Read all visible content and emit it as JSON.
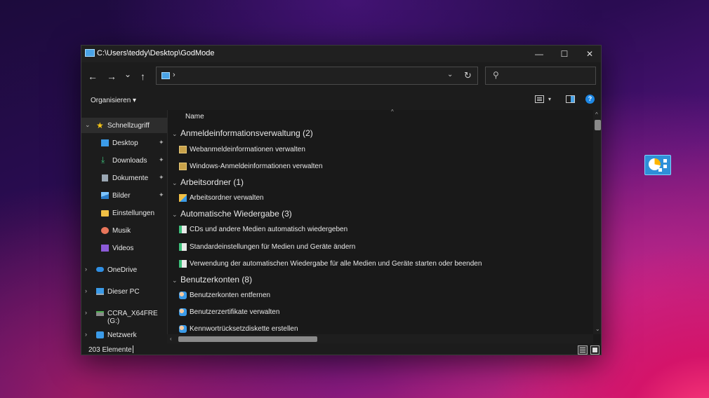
{
  "window": {
    "title": "C:\\Users\\teddy\\Desktop\\GodMode",
    "minimize_glyph": "—",
    "maximize_glyph": "☐",
    "close_glyph": "✕"
  },
  "nav": {
    "back_glyph": "←",
    "forward_glyph": "→",
    "recent_glyph": "⌄",
    "up_glyph": "↑",
    "address_separator": "›",
    "address_dropdown_glyph": "⌄",
    "refresh_glyph": "↻",
    "search_placeholder": "",
    "search_icon_glyph": "⚲"
  },
  "toolbar": {
    "organize_label": "Organisieren ▾",
    "view_caret": "▾",
    "help_glyph": "?"
  },
  "sidebar": {
    "items": [
      {
        "label": "Schnellzugriff",
        "icon": "star-icon",
        "icon_color": "#f5c518",
        "expanded": true,
        "selected": true
      },
      {
        "label": "Desktop",
        "icon": "desktop-icon",
        "icon_color": "#3b9be8",
        "pinned": true
      },
      {
        "label": "Downloads",
        "icon": "download-icon",
        "icon_color": "#3dbf7a",
        "pinned": true
      },
      {
        "label": "Dokumente",
        "icon": "document-icon",
        "icon_color": "#9aa7b3",
        "pinned": true
      },
      {
        "label": "Bilder",
        "icon": "pictures-icon",
        "icon_color": "#3b9be8",
        "pinned": true
      },
      {
        "label": "Einstellungen",
        "icon": "folder-icon",
        "icon_color": "#f1c045"
      },
      {
        "label": "Musik",
        "icon": "music-icon",
        "icon_color": "#e9765b"
      },
      {
        "label": "Videos",
        "icon": "video-icon",
        "icon_color": "#8c5bd8"
      },
      {
        "label": "OneDrive",
        "icon": "cloud-icon",
        "icon_color": "#2f8fe3"
      },
      {
        "label": "Dieser PC",
        "icon": "computer-icon",
        "icon_color": "#3b9be8"
      },
      {
        "label": "CCRA_X64FRE (G:)",
        "icon": "drive-icon",
        "icon_color": "#4caf50"
      },
      {
        "label": "Netzwerk",
        "icon": "network-icon",
        "icon_color": "#3b9be8"
      }
    ],
    "expand_glyph": "›",
    "collapse_glyph": "⌄",
    "pin_glyph": "📌"
  },
  "content": {
    "column_name": "Name",
    "sort_indicator": "^",
    "group_chevron": "⌄",
    "groups": [
      {
        "title": "Anmeldeinformationsverwaltung (2)",
        "items": [
          {
            "label": "Webanmeldeinformationen verwalten",
            "icon": "credential-vault-icon"
          },
          {
            "label": "Windows-Anmeldeinformationen verwalten",
            "icon": "credential-vault-icon"
          }
        ]
      },
      {
        "title": "Arbeitsordner (1)",
        "items": [
          {
            "label": "Arbeitsordner verwalten",
            "icon": "work-folders-icon"
          }
        ]
      },
      {
        "title": "Automatische Wiedergabe (3)",
        "items": [
          {
            "label": "CDs und andere Medien automatisch wiedergeben",
            "icon": "autoplay-icon"
          },
          {
            "label": "Standardeinstellungen für Medien und Geräte ändern",
            "icon": "autoplay-icon"
          },
          {
            "label": "Verwendung der automatischen Wiedergabe für alle Medien und Geräte starten oder beenden",
            "icon": "autoplay-icon"
          }
        ]
      },
      {
        "title": "Benutzerkonten (8)",
        "items": [
          {
            "label": "Benutzerkonten entfernen",
            "icon": "user-accounts-icon"
          },
          {
            "label": "Benutzerzertifikate verwalten",
            "icon": "user-accounts-icon"
          },
          {
            "label": "Kennwortrücksetzdiskette erstellen",
            "icon": "user-accounts-icon"
          }
        ]
      }
    ]
  },
  "status": {
    "item_count": "203 Elemente"
  },
  "scroll": {
    "up_glyph": "^",
    "down_glyph": "⌄",
    "left_glyph": "‹"
  }
}
